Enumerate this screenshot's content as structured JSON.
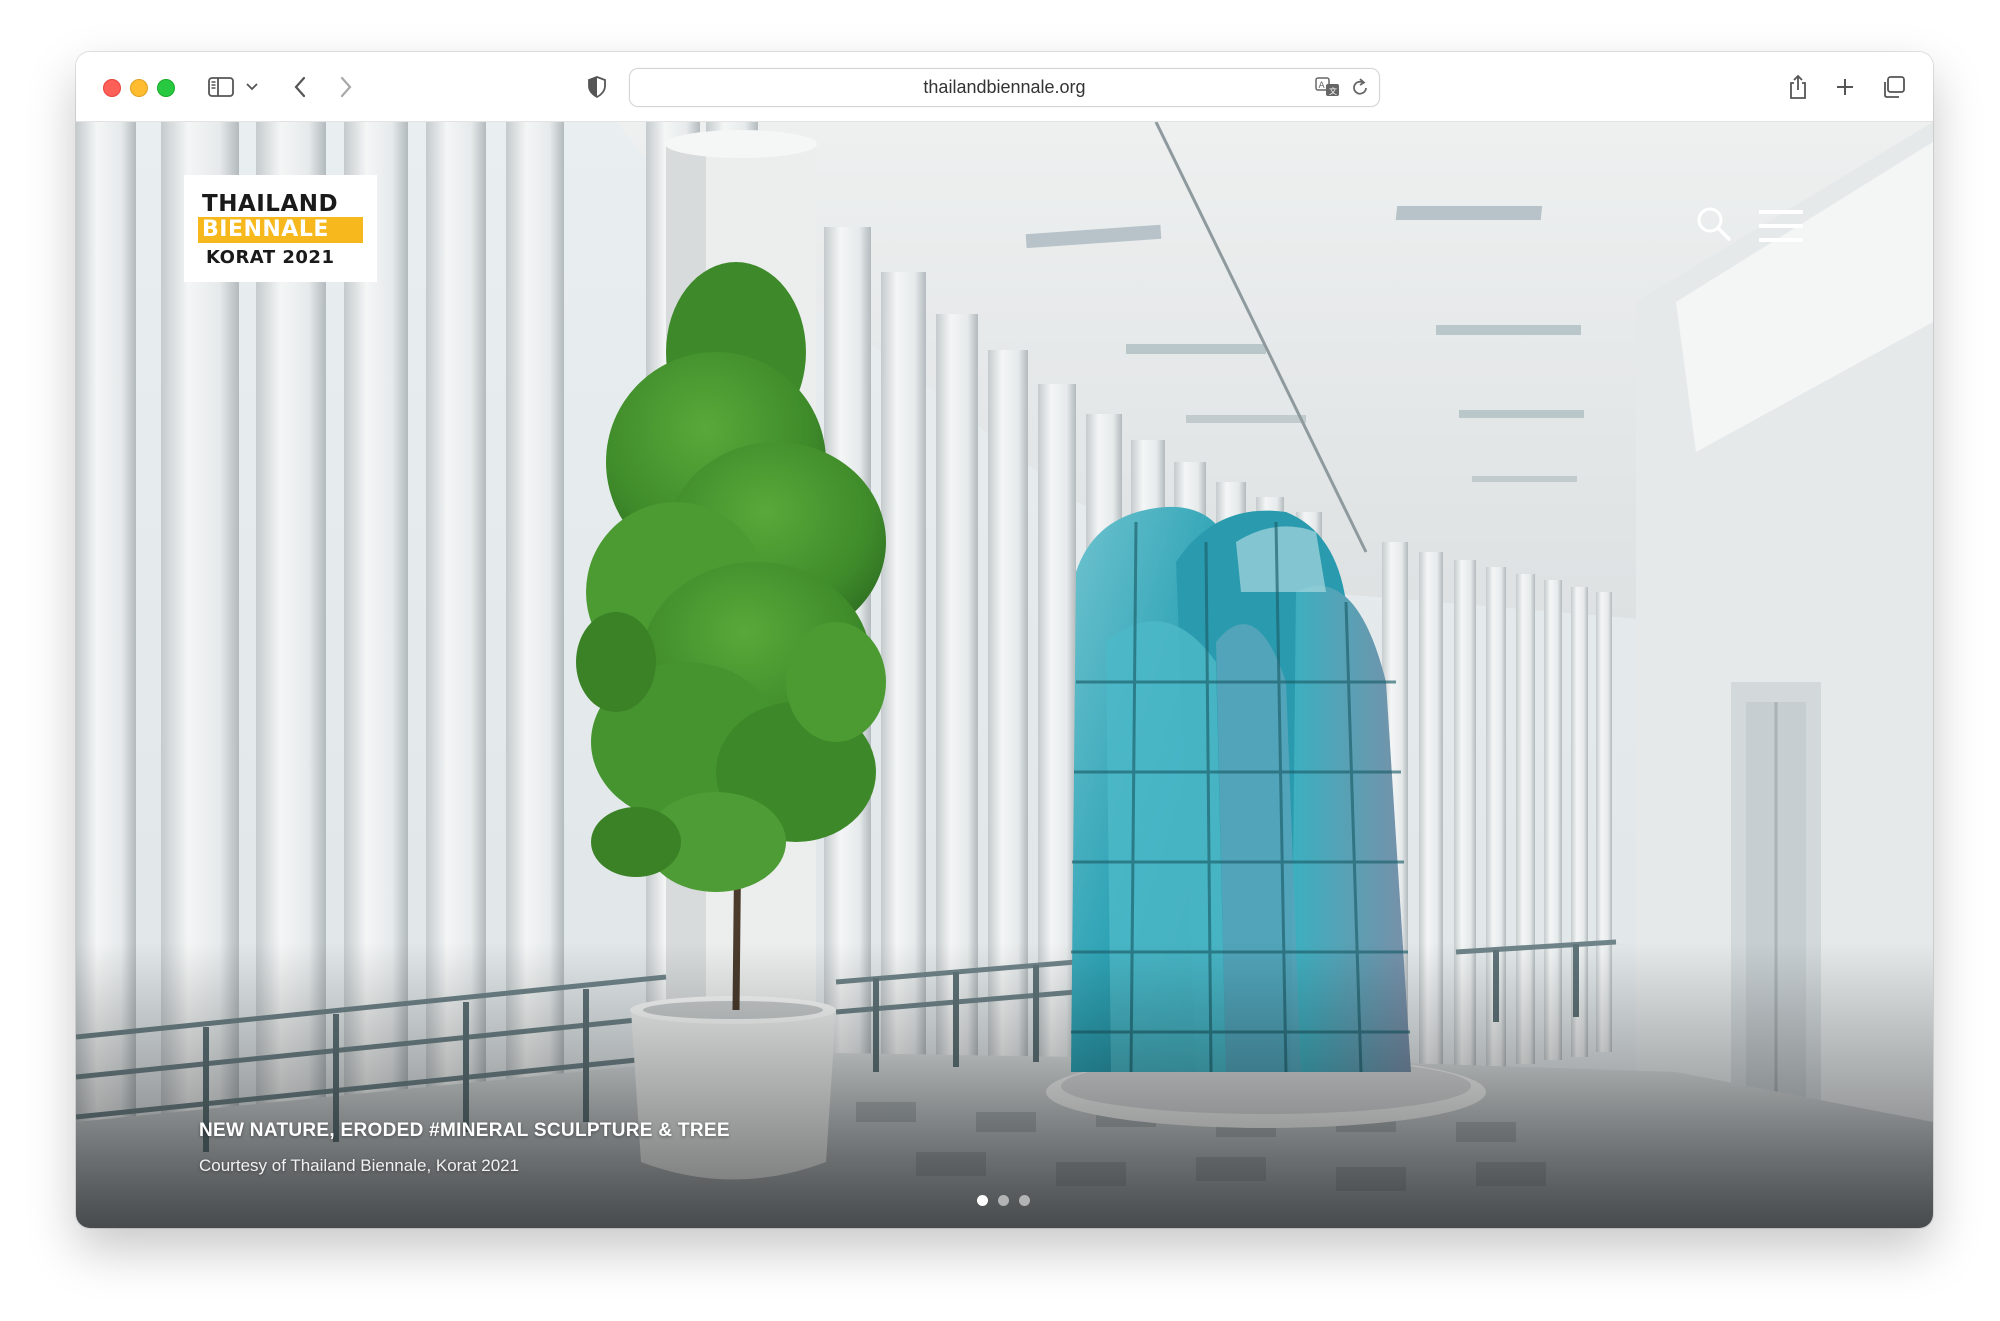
{
  "browser": {
    "url": "thailandbiennale.org",
    "icons": {
      "sidebar": "sidebar-icon",
      "back": "chevron-left-icon",
      "forward": "chevron-right-icon",
      "privacy": "shield-icon",
      "translate": "translate-icon",
      "reload": "reload-icon",
      "share": "share-icon",
      "new_tab": "plus-icon",
      "tabs": "tabs-overview-icon"
    }
  },
  "site": {
    "logo": {
      "line1": "THAILAND",
      "line2": "BIENNALE",
      "line3": "KORAT 2021",
      "accent_color": "#f6b81c"
    },
    "nav": {
      "search_icon": "search-icon",
      "menu_icon": "hamburger-menu-icon"
    },
    "hero": {
      "caption_title": "NEW NATURE, ERODED #MINERAL SCULPTURE & TREE",
      "caption_subtitle": "Courtesy of Thailand Biennale, Korat 2021",
      "slides_total": 3,
      "active_slide": 1,
      "sculpture_color": "#2fa6b8"
    }
  }
}
